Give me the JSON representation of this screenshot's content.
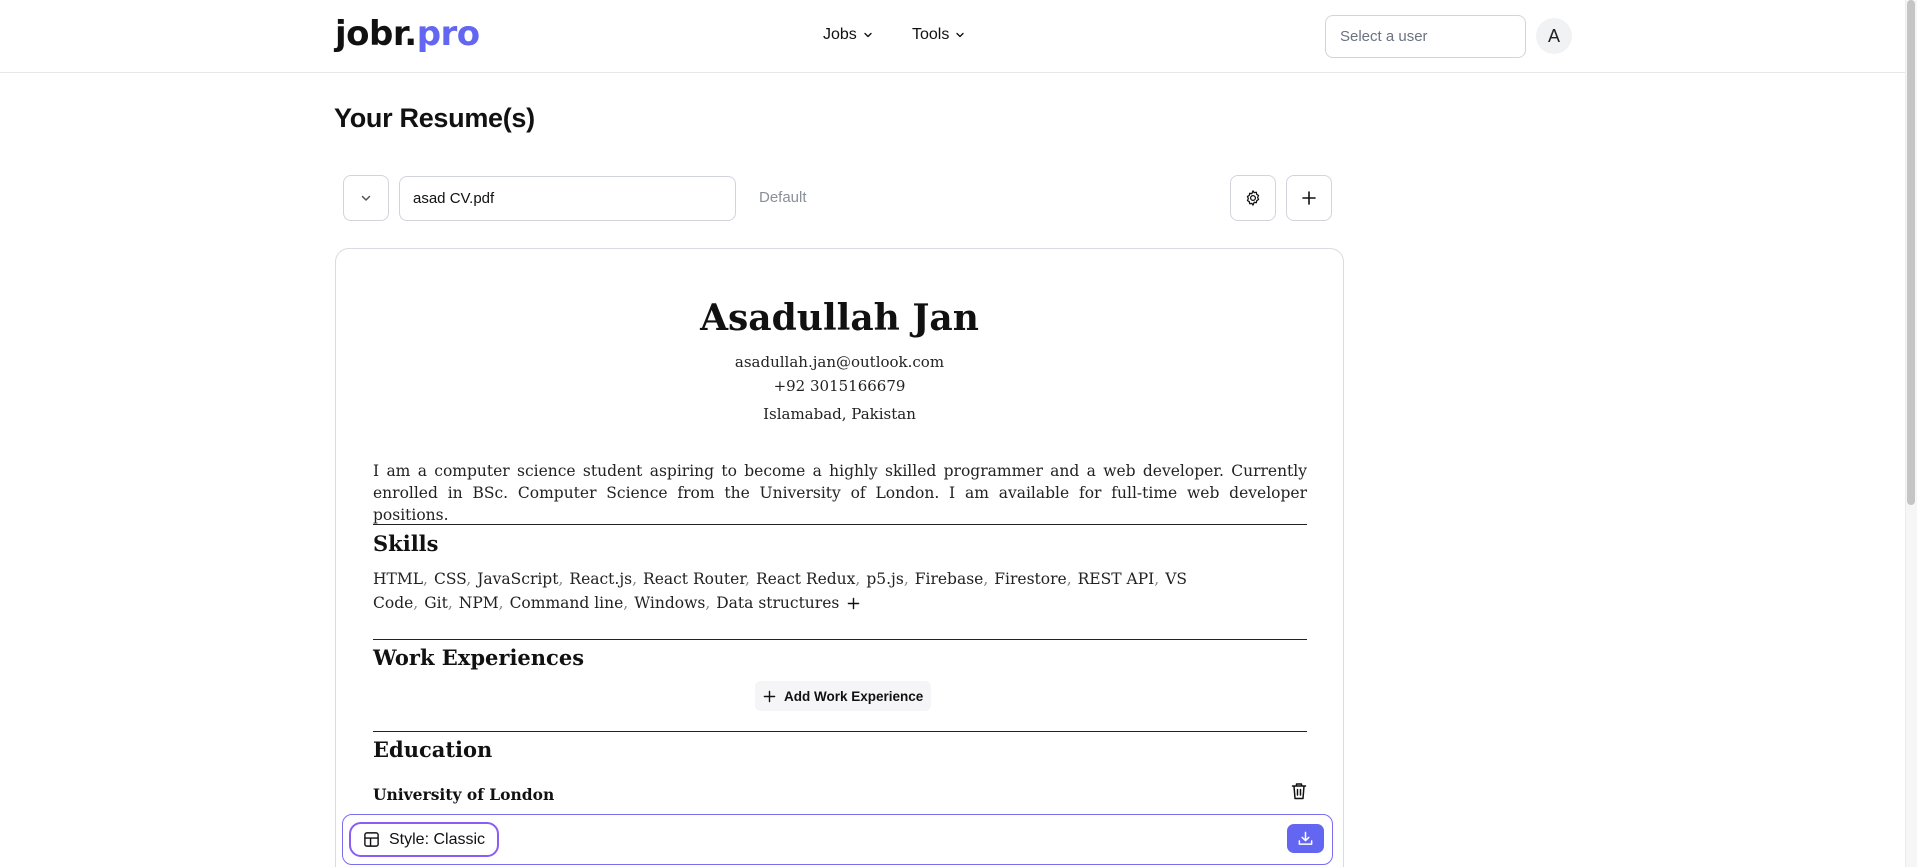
{
  "header": {
    "logo_part1": "jobr.",
    "logo_part2": "pro",
    "nav": {
      "jobs": "Jobs",
      "tools": "Tools"
    },
    "user_select_placeholder": "Select a user",
    "avatar_letter": "A"
  },
  "page": {
    "title": "Your Resume(s)"
  },
  "toolbar": {
    "resume_name": "asad CV.pdf",
    "default_label": "Default"
  },
  "resume": {
    "name": "Asadullah Jan",
    "email": "asadullah.jan@outlook.com",
    "phone": "+92 3015166679",
    "location": "Islamabad, Pakistan",
    "summary": "I am a computer science student aspiring to become a highly skilled programmer and a web developer. Currently enrolled in BSc. Computer Science from the University of London. I am available for full-time web developer positions.",
    "sections": {
      "skills": "Skills",
      "work": "Work Experiences",
      "education": "Education"
    },
    "skills": [
      "HTML",
      "CSS",
      "JavaScript",
      "React.js",
      "React Router",
      "React Redux",
      "p5.js",
      "Firebase",
      "Firestore",
      "REST API",
      "VS Code",
      "Git",
      "NPM",
      "Command line",
      "Windows",
      "Data structures"
    ],
    "add_work_label": "Add Work Experience",
    "education_items": [
      "University of London"
    ]
  },
  "stylebar": {
    "style_label": "Style: Classic"
  },
  "colors": {
    "brand_accent": "#6366f1",
    "pill_border": "#8b5cf6"
  }
}
